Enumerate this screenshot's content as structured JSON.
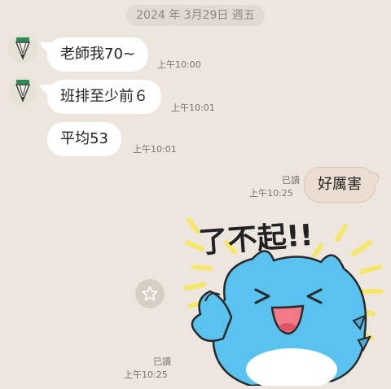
{
  "date_label": "2024 年 3月29日 週五",
  "messages": [
    {
      "text": "老師我70~",
      "time": "上午10:00"
    },
    {
      "text": "班排至少前６",
      "time": "上午10:01"
    },
    {
      "text": "平均53",
      "time": "上午10:01"
    }
  ],
  "outgoing": {
    "text": "好厲害",
    "read": "已讀",
    "time": "上午10:25"
  },
  "sticker": {
    "text": "了不起!!",
    "read": "已讀",
    "time": "上午10:25"
  },
  "icons": [
    "pencil-avatar-icon",
    "star-icon"
  ],
  "colors": {
    "background": "#EDE6DF",
    "outgoing_bubble": "#EBDDCF",
    "sticker_character": "#5AC2EE",
    "sticker_rays": "#F4E76A"
  }
}
